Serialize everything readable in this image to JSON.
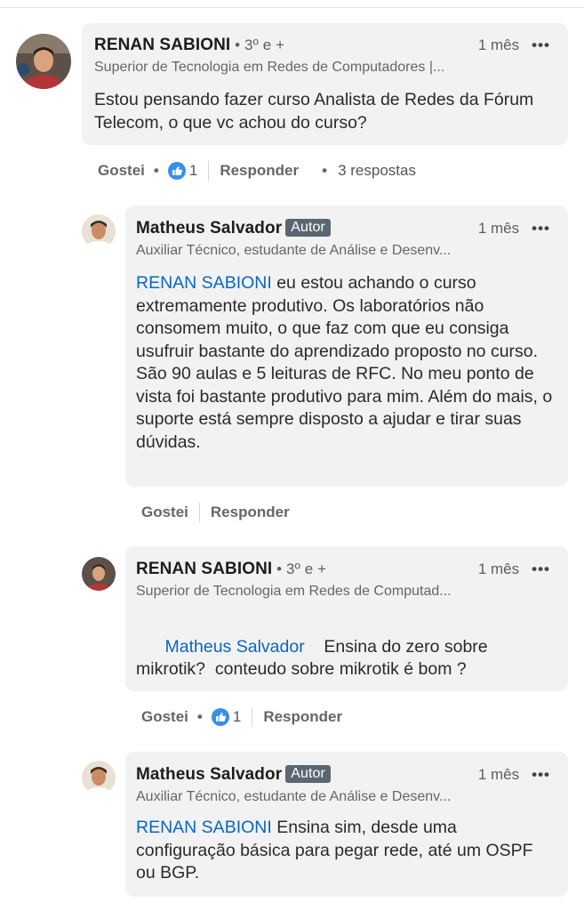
{
  "comments": [
    {
      "author": "RENAN SABIONI",
      "degree": " • 3º e +",
      "time": "1 mês",
      "more": "•••",
      "headline": "Superior de Tecnologia em Redes de Computadores |...",
      "text": "Estou pensando fazer curso Analista de Redes da Fórum Telecom, o que vc achou do curso?",
      "actions": {
        "like": "Gostei",
        "like_count": "1",
        "reply": "Responder",
        "replies": "3 respostas"
      }
    },
    {
      "author": "Matheus Salvador",
      "badge": "Autor",
      "time": "1 mês",
      "more": "•••",
      "headline": "Auxiliar Técnico, estudante de Análise e Desenv...",
      "mention": "RENAN SABIONI",
      "text": " eu estou achando o curso extremamente produtivo. Os laboratórios não consomem muito, o que faz com que eu consiga usufruir bastante do aprendizado proposto no curso. São 90 aulas e 5 leituras de RFC. No meu ponto de vista foi bastante produtivo para mim. Além do mais, o suporte está sempre disposto a ajudar e tirar suas dúvidas.",
      "actions": {
        "like": "Gostei",
        "reply": "Responder"
      }
    },
    {
      "author": "RENAN SABIONI",
      "degree": " • 3º e +",
      "time": "1 mês",
      "more": "•••",
      "headline": "Superior de Tecnologia em Redes de Computad...",
      "mention": "Matheus Salvador",
      "text": "    Ensina do zero sobre mikrotik?  conteudo sobre mikrotik é bom ?",
      "actions": {
        "like": "Gostei",
        "like_count": "1",
        "reply": "Responder"
      }
    },
    {
      "author": "Matheus Salvador",
      "badge": "Autor",
      "time": "1 mês",
      "more": "•••",
      "headline": "Auxiliar Técnico, estudante de Análise e Desenv...",
      "mention": "RENAN SABIONI",
      "text": " Ensina sim, desde uma configuração básica para pegar rede, até um OSPF ou BGP."
    }
  ],
  "colors": {
    "mention": "#0a66c2",
    "badge": "#5a6671",
    "bubble": "#f2f2f2",
    "like_blue": "#378fe9"
  },
  "icons": {
    "like": "thumbs-up-icon",
    "more": "more-options-icon"
  }
}
